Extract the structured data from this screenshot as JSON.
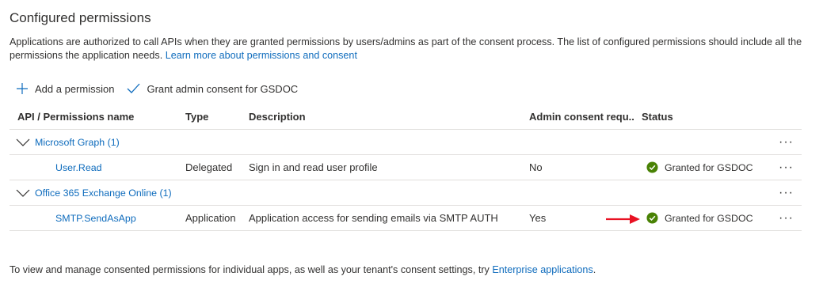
{
  "section": {
    "title": "Configured permissions",
    "description": "Applications are authorized to call APIs when they are granted permissions by users/admins as part of the consent process. The list of configured permissions should include all the permissions the application needs.",
    "learn_more_link": "Learn more about permissions and consent"
  },
  "toolbar": {
    "add_permission_label": "Add a permission",
    "grant_consent_label": "Grant admin consent for GSDOC"
  },
  "table": {
    "headers": {
      "api_name": "API / Permissions name",
      "type": "Type",
      "description": "Description",
      "admin_consent": "Admin consent requ...",
      "status": "Status"
    },
    "groups": [
      {
        "name": "Microsoft Graph (1)",
        "permissions": [
          {
            "name": "User.Read",
            "type": "Delegated",
            "description": "Sign in and read user profile",
            "admin_consent": "No",
            "status": "Granted for GSDOC"
          }
        ]
      },
      {
        "name": "Office 365 Exchange Online (1)",
        "permissions": [
          {
            "name": "SMTP.SendAsApp",
            "type": "Application",
            "description": "Application access for sending emails via SMTP AUTH",
            "admin_consent": "Yes",
            "status": "Granted for GSDOC"
          }
        ]
      }
    ],
    "more_glyph": "···"
  },
  "footer": {
    "text": "To view and manage consented permissions for individual apps, as well as your tenant's consent settings, try",
    "link": "Enterprise applications",
    "end": "."
  },
  "colors": {
    "link": "#0f6cbd",
    "success": "#498205",
    "annotation_arrow": "#e81123"
  },
  "icons": {
    "add": "plus-icon",
    "grant": "checkmark-icon",
    "expand": "chevron-down-icon",
    "status": "success-check-circle-icon",
    "annotation": "red-arrow-icon"
  }
}
